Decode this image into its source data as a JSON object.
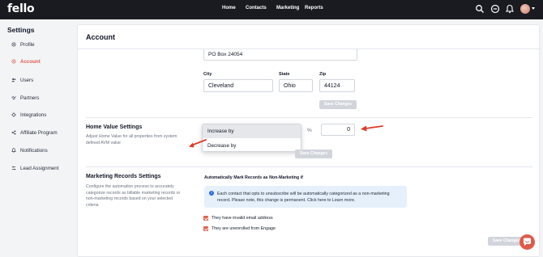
{
  "app": {
    "logo": "fello"
  },
  "topnav": {
    "links": [
      "Home",
      "Contacts",
      "Marketing",
      "Reports"
    ]
  },
  "sidebar": {
    "title": "Settings",
    "items": [
      {
        "label": "Profile",
        "icon": "gear-icon",
        "active": false
      },
      {
        "label": "Account",
        "icon": "gear-icon",
        "active": true
      },
      {
        "label": "Users",
        "icon": "users-icon",
        "active": false
      },
      {
        "label": "Partners",
        "icon": "handshake-icon",
        "active": false
      },
      {
        "label": "Integrations",
        "icon": "integrations-icon",
        "active": false
      },
      {
        "label": "Affiliate Program",
        "icon": "share-icon",
        "active": false
      },
      {
        "label": "Notifications",
        "icon": "bell-icon",
        "active": false
      },
      {
        "label": "Lead Assignment",
        "icon": "sliders-icon",
        "active": false
      }
    ]
  },
  "account": {
    "title": "Account",
    "address_line": "PO Box 24054",
    "city_label": "City",
    "city_value": "Cleveland",
    "state_label": "State",
    "state_value": "Ohio",
    "zip_label": "Zip",
    "zip_value": "44124",
    "save_label": "Save Changes"
  },
  "home_value": {
    "title": "Home Value Settings",
    "description": "Adjust Home Value for all properties from system defined AVM value",
    "options": [
      "Increase by",
      "Decrease by"
    ],
    "highlighted_option": "Increase by",
    "percent_symbol": "%",
    "percent_value": "0",
    "save_label": "Save Changes"
  },
  "marketing": {
    "title": "Marketing Records Settings",
    "description": "Configure the automation process to accurately categorize records as billable marketing records or non-marketing records based on your selected criteria",
    "heading": "Automatically Mark Records as Non-Marketing if",
    "info_icon": "info-icon",
    "info_text": "Each contact that opts to unsubscribe will be automatically categorized as a non-marketing record. Please note, this change is permanent. Click here to Learn more.",
    "checkboxes": [
      {
        "label": "They have invalid email address",
        "checked": true
      },
      {
        "label": "They are unenrolled from Engage",
        "checked": true
      }
    ],
    "save_label": "Save Changes"
  },
  "colors": {
    "accent": "#e05a4b",
    "topbar": "#1a1b20",
    "annotation_arrow": "#e03a2a",
    "info_bg": "#e6f0fa"
  }
}
